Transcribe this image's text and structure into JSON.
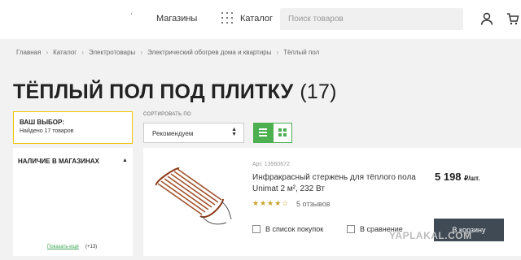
{
  "header": {
    "stores_label": "Магазины",
    "catalog_label": "Каталог",
    "search_placeholder": "Поиск товаров",
    "icons": [
      "chevron-down-icon",
      "catalog-grid-icon",
      "user-icon",
      "cart-icon"
    ]
  },
  "breadcrumbs": [
    "Главная",
    "Каталог",
    "Электротовары",
    "Электрический обогрев дома и квартиры",
    "Тёплый пол"
  ],
  "page": {
    "title": "ТЁПЛЫЙ ПОЛ ПОД ПЛИТКУ",
    "count": "(17)"
  },
  "choice": {
    "title": "ВАШ ВЫБОР:",
    "found": "Найдено 17 товаров"
  },
  "sort": {
    "label": "СОРТИРОВАТЬ ПО",
    "selected": "Рекомендуем"
  },
  "filter": {
    "title": "НАЛИЧИЕ В МАГАЗИНАХ",
    "show_more": "Показать ещё",
    "more_count": "(+13)"
  },
  "product": {
    "article": "Арт. 13560672",
    "name": "Инфракрасный стержень для тёплого пола Unimat 2 м², 232 Вт",
    "rating": 3.5,
    "stars_text": "★★★★☆",
    "reviews": "5 отзывов",
    "price": "5 198",
    "price_unit": "₽/шт.",
    "shopping_list": "В список покупок",
    "compare": "В сравнение",
    "buy": "В корзину"
  },
  "watermark": "YAPLAKAL.COM",
  "colors": {
    "accent_green": "#4caf50",
    "highlight_yellow": "#f2c200",
    "buy_button": "#3f4a55"
  }
}
